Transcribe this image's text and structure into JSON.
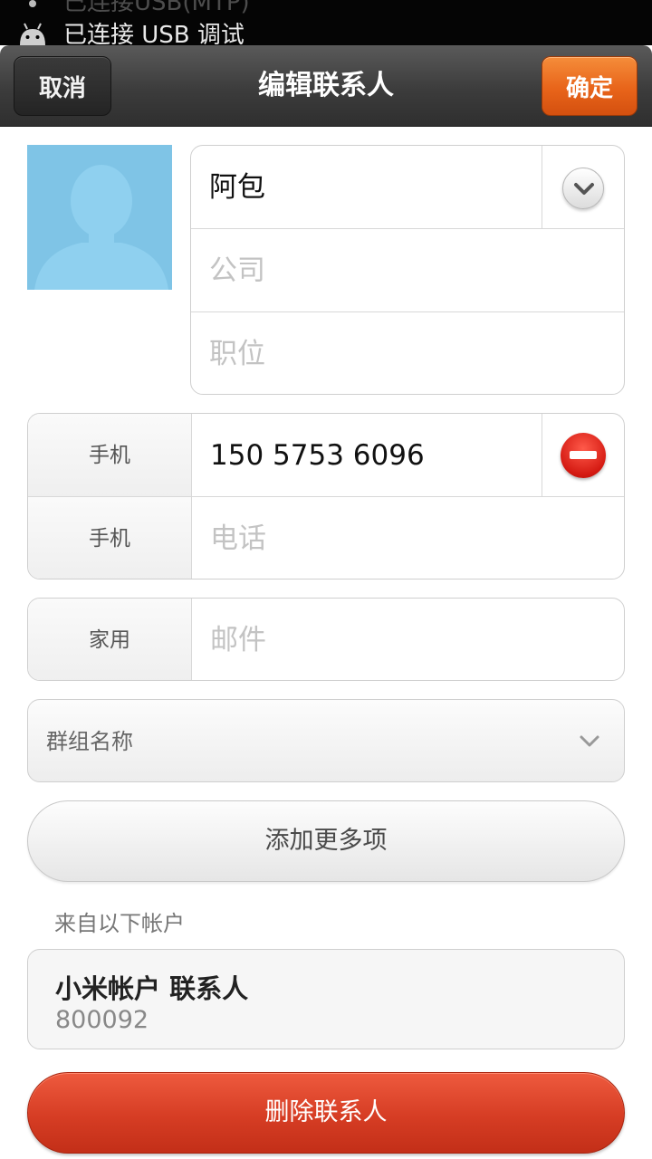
{
  "status_bar": {
    "notification_text": "已连接 USB 调试",
    "partial_text": "已连接USB(MTP)"
  },
  "header": {
    "cancel_label": "取消",
    "title": "编辑联系人",
    "confirm_label": "确定"
  },
  "name_section": {
    "name_value": "阿包",
    "company_placeholder": "公司",
    "job_title_placeholder": "职位"
  },
  "phone_section": {
    "rows": [
      {
        "type_label": "手机",
        "value": "150 5753 6096"
      },
      {
        "type_label": "手机",
        "placeholder": "电话"
      }
    ]
  },
  "email_section": {
    "type_label": "家用",
    "placeholder": "邮件"
  },
  "group_select": {
    "label": "群组名称"
  },
  "add_more_label": "添加更多项",
  "account_section": {
    "heading": "来自以下帐户",
    "account_name": "小米帐户 联系人",
    "account_id": "800092"
  },
  "delete_label": "删除联系人",
  "colors": {
    "confirm_orange": "#e8641a",
    "delete_red": "#d63d24",
    "avatar_blue": "#7fc4e6"
  }
}
